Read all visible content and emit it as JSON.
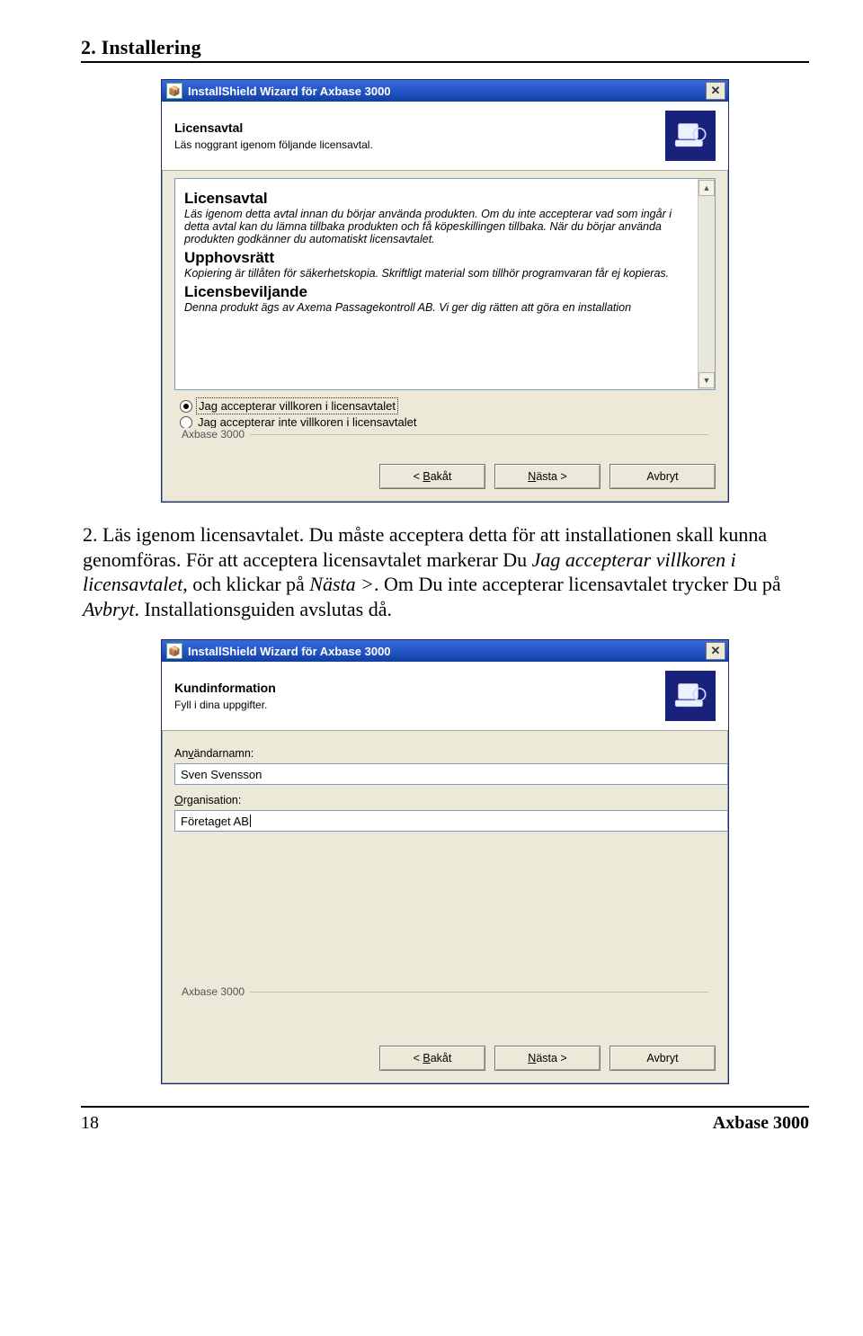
{
  "doc": {
    "section_heading": "2. Installering",
    "step_label": "2.",
    "step_prefix": "Läs igenom licensavtalet. Du måste acceptera detta för att installationen skall kunna genomföras. För att acceptera licensavtalet markerar Du ",
    "italic1": "Jag accepterar villkoren i licensavtalet",
    "mid1": ", och klickar på ",
    "italic2": "Nästa >",
    "mid2": ". Om Du inte accepterar licensavtalet trycker Du på ",
    "italic3": "Avbryt",
    "tail": ". Installationsguiden avslutas då.",
    "footer_page": "18",
    "footer_title": "Axbase 3000"
  },
  "dialog1": {
    "title": "InstallShield Wizard för Axbase 3000",
    "header_title": "Licensavtal",
    "header_sub": "Läs noggrant igenom följande licensavtal.",
    "lic_h1": "Licensavtal",
    "lic_p1": "Läs igenom detta avtal innan du börjar använda produkten. Om du inte accepterar vad som ingår i detta avtal kan du lämna tillbaka produkten och få köpeskillingen tillbaka. När du börjar använda produkten godkänner du automatiskt licensavtalet.",
    "lic_h2": "Upphovsrätt",
    "lic_p2": "Kopiering är tillåten för säkerhetskopia. Skriftligt material som tillhör programvaran får ej kopieras.",
    "lic_h3": "Licensbeviljande",
    "lic_p3": "Denna produkt ägs av Axema Passagekontroll AB. Vi ger dig rätten att göra en installation",
    "radio_accept": "Jag accepterar villkoren i licensavtalet",
    "radio_reject": "Jag accepterar inte villkoren i licensavtalet",
    "brand": "Axbase 3000",
    "btn_back": "< Bakåt",
    "btn_next": "Nästa >",
    "btn_cancel": "Avbryt"
  },
  "dialog2": {
    "title": "InstallShield Wizard för Axbase 3000",
    "header_title": "Kundinformation",
    "header_sub": "Fyll i dina uppgifter.",
    "field_user_label": "Användarnamn:",
    "field_user_value": "Sven Svensson",
    "field_org_label": "Organisation:",
    "field_org_value": "Företaget AB",
    "brand": "Axbase 3000",
    "btn_back": "< Bakåt",
    "btn_next": "Nästa >",
    "btn_cancel": "Avbryt"
  }
}
